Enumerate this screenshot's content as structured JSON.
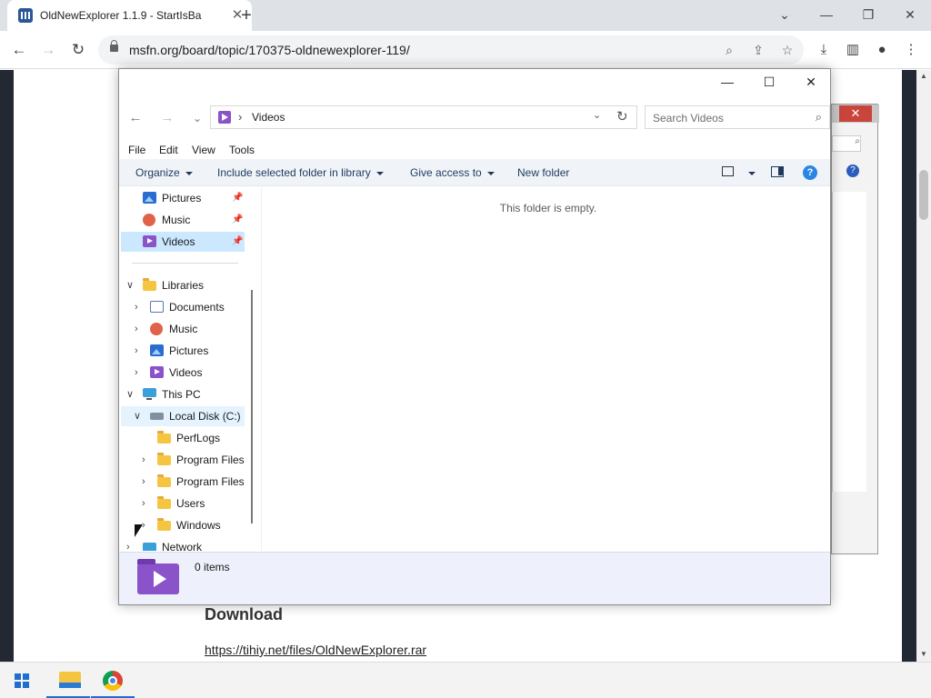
{
  "browser": {
    "tab_title": "OldNewExplorer 1.1.9 - StartIsBa",
    "tab_close": "✕",
    "new_tab": "+",
    "url": "msfn.org/board/topic/170375-oldnewexplorer-119/",
    "window_controls": {
      "chevron": "⌄",
      "minimize": "—",
      "restore": "❐",
      "close": "✕"
    },
    "nav": {
      "back": "←",
      "forward": "→",
      "reload": "↻"
    }
  },
  "page": {
    "download_heading": "Download",
    "download_link": "https://tihiy.net/files/OldNewExplorer.rar"
  },
  "explorer": {
    "controls": {
      "minimize": "—",
      "maximize": "☐",
      "close": "✕"
    },
    "nav": {
      "back": "←",
      "forward": "→",
      "recent": "⌄"
    },
    "address": {
      "separator": "›",
      "location": "Videos"
    },
    "search_placeholder": "Search Videos",
    "menu": [
      "File",
      "Edit",
      "View",
      "Tools"
    ],
    "commands": {
      "organize": "Organize",
      "include": "Include selected folder in library",
      "share": "Give access to",
      "new_folder": "New folder"
    },
    "help": "?",
    "nav_pane": {
      "quick_access": [
        {
          "label": "Pictures",
          "icon": "pictures-icon",
          "pinned": true
        },
        {
          "label": "Music",
          "icon": "music-icon",
          "pinned": true
        },
        {
          "label": "Videos",
          "icon": "videos-icon",
          "pinned": true,
          "selected": true
        }
      ],
      "libraries_label": "Libraries",
      "libraries": [
        "Documents",
        "Music",
        "Pictures",
        "Videos"
      ],
      "this_pc_label": "This PC",
      "local_disk_label": "Local Disk (C:)",
      "disk_folders": [
        "PerfLogs",
        "Program Files",
        "Program Files",
        "Users",
        "Windows"
      ],
      "network_label": "Network"
    },
    "content_message": "This folder is empty.",
    "status": "0 items"
  },
  "colors": {
    "accent": "#1f6fd1",
    "selected_bg": "#cce8ff",
    "videos_purple": "#8b53c9",
    "details_bg": "#eef1fb"
  }
}
